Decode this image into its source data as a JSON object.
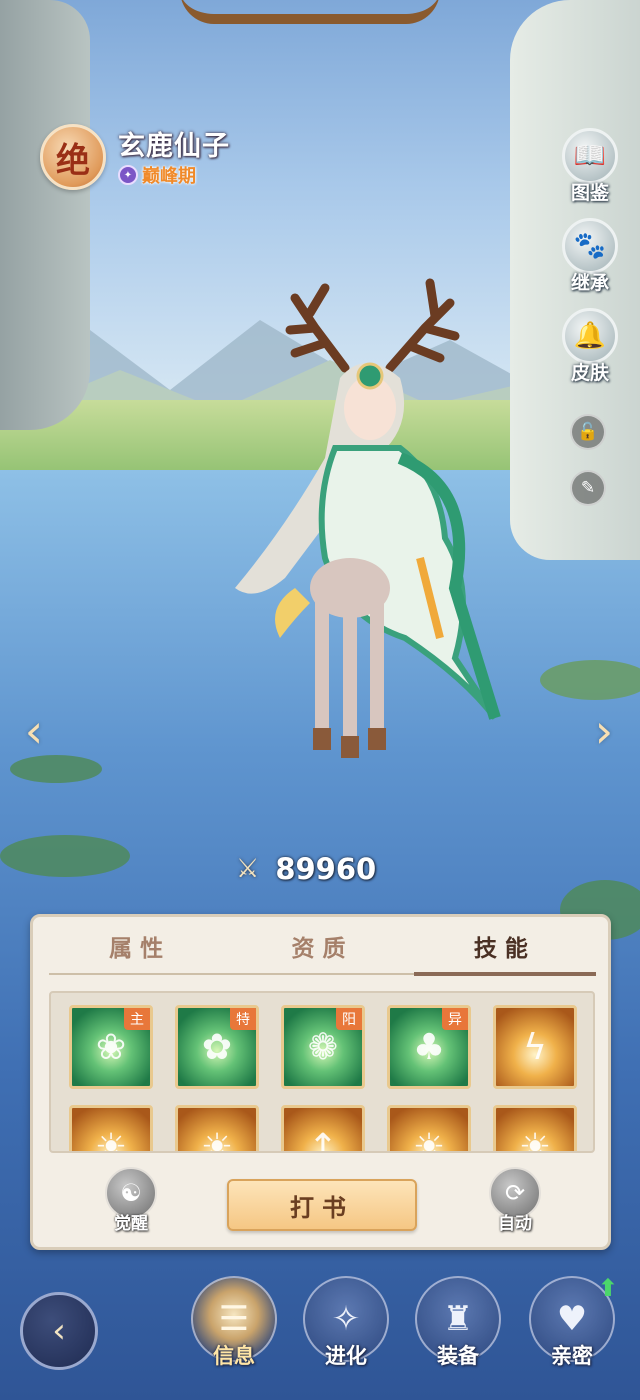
{
  "character": {
    "rank_label": "绝",
    "name": "玄鹿仙子",
    "stage": "巅峰期",
    "power": "89960"
  },
  "side_menu": [
    {
      "label": "图鉴",
      "icon": "book-icon"
    },
    {
      "label": "继承",
      "icon": "spirit-icon"
    },
    {
      "label": "皮肤",
      "icon": "bell-icon"
    }
  ],
  "side_small": [
    {
      "icon": "lock-open-icon"
    },
    {
      "icon": "quill-icon"
    }
  ],
  "tabs": [
    {
      "label": "属性",
      "active": false
    },
    {
      "label": "资质",
      "active": false
    },
    {
      "label": "技能",
      "active": true
    }
  ],
  "skills": [
    {
      "tag": "主",
      "style": "green",
      "icon": "leaf-circle-icon"
    },
    {
      "tag": "特",
      "style": "green",
      "icon": "flower-burst-icon"
    },
    {
      "tag": "阳",
      "style": "green",
      "icon": "blossom-icon"
    },
    {
      "tag": "异",
      "style": "green",
      "icon": "sprite-icon"
    },
    {
      "tag": "",
      "style": "gold",
      "icon": "lightning-orb-icon"
    },
    {
      "tag": "",
      "style": "gold",
      "icon": "bell-skill-icon"
    },
    {
      "tag": "",
      "style": "gold",
      "icon": "demon-skill-icon"
    },
    {
      "tag": "",
      "style": "gold",
      "icon": "arrow-up-skill-icon"
    },
    {
      "tag": "",
      "style": "gold",
      "icon": "wave-skill-icon"
    },
    {
      "tag": "",
      "style": "gold",
      "icon": "horn-skill-icon"
    }
  ],
  "panel_actions": {
    "awaken_label": "觉醒",
    "book_label": "打书",
    "auto_label": "自动"
  },
  "bottom_nav": [
    {
      "label": "信息",
      "active": true,
      "icon": "scroll-icon"
    },
    {
      "label": "进化",
      "active": false,
      "icon": "evolve-icon"
    },
    {
      "label": "装备",
      "active": false,
      "icon": "armor-icon"
    },
    {
      "label": "亲密",
      "active": false,
      "icon": "hearts-icon"
    }
  ],
  "colors": {
    "accent_gold": "#f5c784",
    "panel_bg": "#f3eee5",
    "tag_orange": "#e8773a",
    "stage_orange": "#f08a2a"
  }
}
